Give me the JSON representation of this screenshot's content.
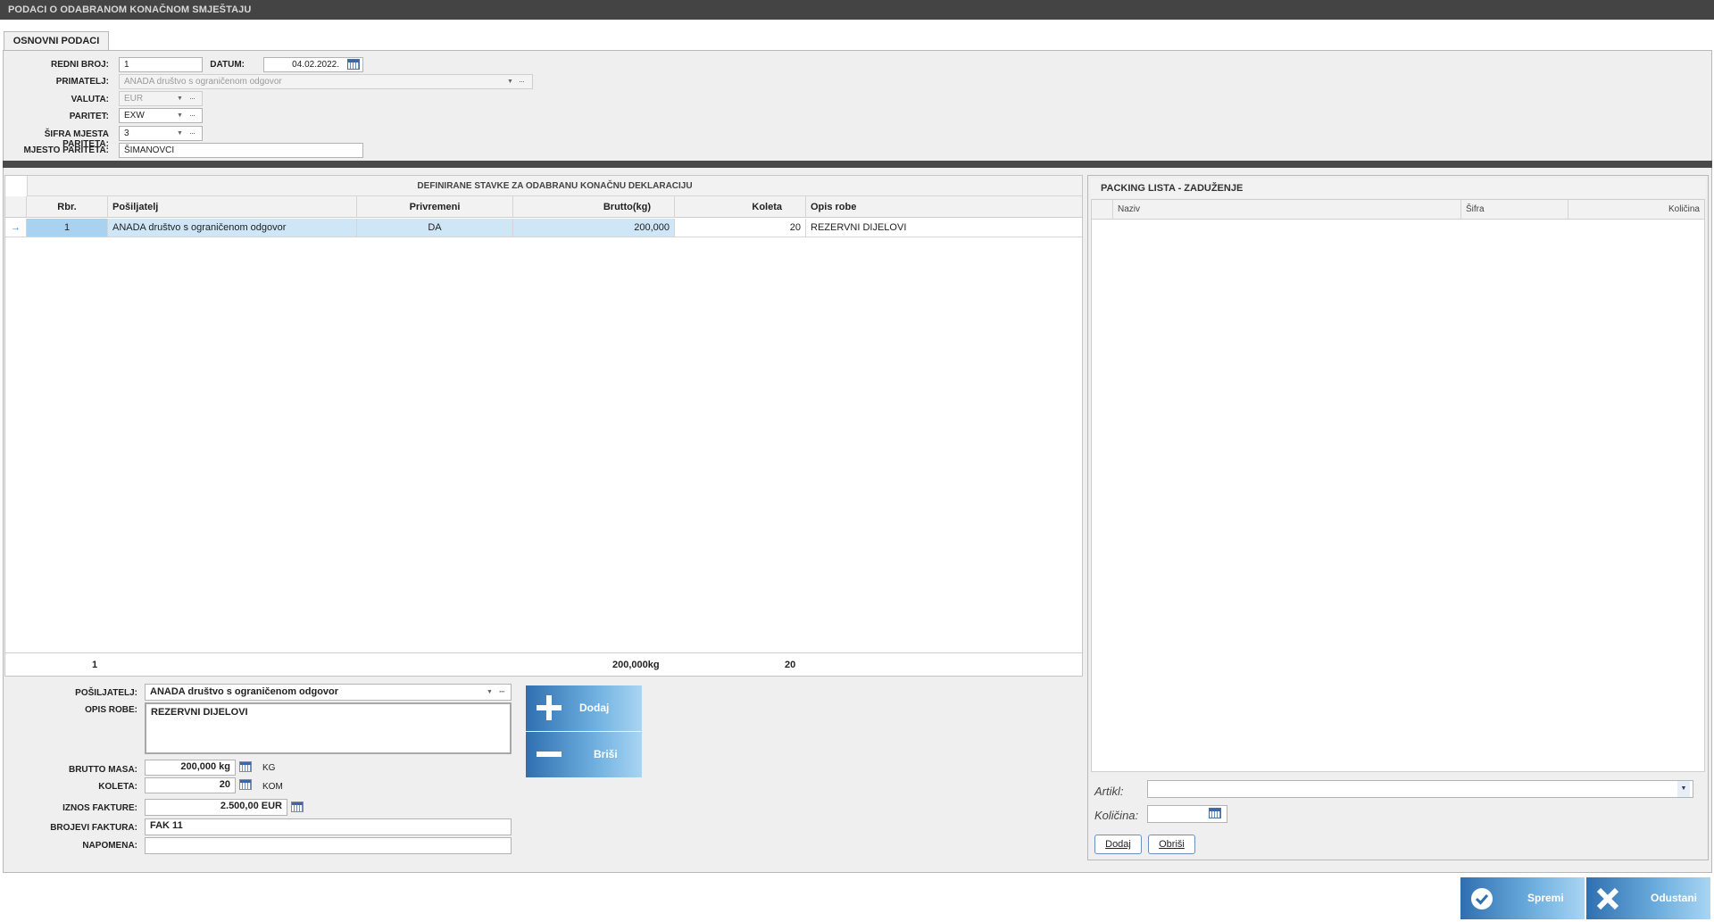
{
  "window": {
    "title": "PODACI O ODABRANOM KONAČNOM SMJEŠTAJU"
  },
  "tabs": [
    {
      "label": "OSNOVNI PODACI"
    }
  ],
  "form": {
    "redni_broj_label": "REDNI BROJ:",
    "redni_broj_value": "1",
    "datum_label": "DATUM:",
    "datum_value": "04.02.2022.",
    "primatelj_label": "PRIMATELJ:",
    "primatelj_value": "ANADA društvo s ograničenom odgovor",
    "valuta_label": "VALUTA:",
    "valuta_value": "EUR",
    "paritet_label": "PARITET:",
    "paritet_value": "EXW",
    "sifra_label": "ŠIFRA MJESTA PARITETA:",
    "sifra_value": "3",
    "mjesto_label": "MJESTO PARITETA:",
    "mjesto_value": "ŠIMANOVCI",
    "ellipsis": "···"
  },
  "grid": {
    "caption": "DEFINIRANE STAVKE ZA ODABRANU KONAČNU DEKLARACIJU",
    "columns": [
      "Rbr.",
      "Pošiljatelj",
      "Privremeni",
      "Brutto(kg)",
      "Koleta",
      "Opis robe"
    ],
    "rows": [
      {
        "indicator": "→",
        "rbr": "1",
        "posiljatelj": "ANADA društvo s ograničenom odgovor",
        "privremeni": "DA",
        "brutto": "200,000",
        "koleta": "20",
        "opis": "REZERVNI DIJELOVI"
      }
    ],
    "footer": {
      "count": "1",
      "brutto_total": "200,000kg",
      "koleta_total": "20"
    }
  },
  "detail": {
    "posiljatelj_label": "POŠILJATELJ:",
    "posiljatelj_value": "ANADA društvo s ograničenom odgovor",
    "opis_label": "OPIS ROBE:",
    "opis_value": "REZERVNI DIJELOVI",
    "brutto_label": "BRUTTO MASA:",
    "brutto_value": "200,000 kg",
    "brutto_unit": "KG",
    "koleta_label": "KOLETA:",
    "koleta_value": "20",
    "koleta_unit": "KOM",
    "iznos_label": "IZNOS FAKTURE:",
    "iznos_value": "2.500,00 EUR",
    "brojevi_label": "BROJEVI FAKTURA:",
    "brojevi_value": "FAK 11",
    "napomena_label": "NAPOMENA:",
    "napomena_value": "",
    "add_button": "Dodaj",
    "delete_button": "Briši"
  },
  "packing": {
    "caption": "PACKING LISTA - ZADUŽENJE",
    "columns": [
      "Naziv",
      "Šifra",
      "Količina"
    ],
    "artikl_label": "Artikl:",
    "artikl_value": "",
    "kolicina_label": "Količina:",
    "kolicina_value": "",
    "add_button": "Dodaj",
    "delete_button": "Obriši"
  },
  "actions": {
    "save": "Spremi",
    "cancel": "Odustani"
  },
  "colors": {
    "titlebar": "#444444",
    "accent": "#2f6fb0",
    "selection": "#cfe6f7"
  }
}
